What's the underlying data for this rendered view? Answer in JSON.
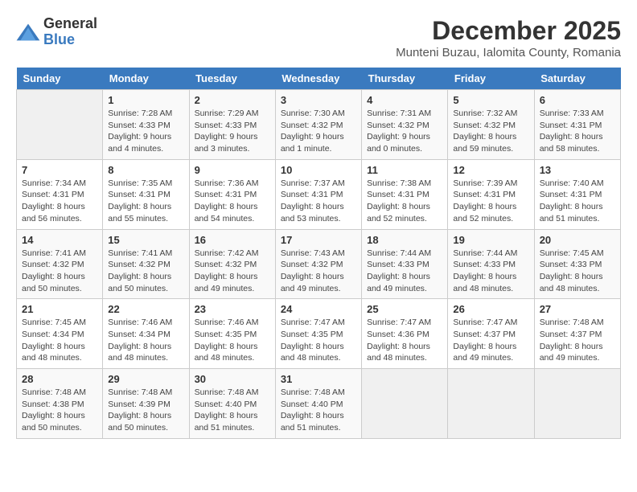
{
  "logo": {
    "text_general": "General",
    "text_blue": "Blue"
  },
  "title": {
    "month_year": "December 2025",
    "location": "Munteni Buzau, Ialomita County, Romania"
  },
  "days_of_week": [
    "Sunday",
    "Monday",
    "Tuesday",
    "Wednesday",
    "Thursday",
    "Friday",
    "Saturday"
  ],
  "weeks": [
    [
      {
        "day": "",
        "info": ""
      },
      {
        "day": "1",
        "info": "Sunrise: 7:28 AM\nSunset: 4:33 PM\nDaylight: 9 hours\nand 4 minutes."
      },
      {
        "day": "2",
        "info": "Sunrise: 7:29 AM\nSunset: 4:33 PM\nDaylight: 9 hours\nand 3 minutes."
      },
      {
        "day": "3",
        "info": "Sunrise: 7:30 AM\nSunset: 4:32 PM\nDaylight: 9 hours\nand 1 minute."
      },
      {
        "day": "4",
        "info": "Sunrise: 7:31 AM\nSunset: 4:32 PM\nDaylight: 9 hours\nand 0 minutes."
      },
      {
        "day": "5",
        "info": "Sunrise: 7:32 AM\nSunset: 4:32 PM\nDaylight: 8 hours\nand 59 minutes."
      },
      {
        "day": "6",
        "info": "Sunrise: 7:33 AM\nSunset: 4:31 PM\nDaylight: 8 hours\nand 58 minutes."
      }
    ],
    [
      {
        "day": "7",
        "info": "Sunrise: 7:34 AM\nSunset: 4:31 PM\nDaylight: 8 hours\nand 56 minutes."
      },
      {
        "day": "8",
        "info": "Sunrise: 7:35 AM\nSunset: 4:31 PM\nDaylight: 8 hours\nand 55 minutes."
      },
      {
        "day": "9",
        "info": "Sunrise: 7:36 AM\nSunset: 4:31 PM\nDaylight: 8 hours\nand 54 minutes."
      },
      {
        "day": "10",
        "info": "Sunrise: 7:37 AM\nSunset: 4:31 PM\nDaylight: 8 hours\nand 53 minutes."
      },
      {
        "day": "11",
        "info": "Sunrise: 7:38 AM\nSunset: 4:31 PM\nDaylight: 8 hours\nand 52 minutes."
      },
      {
        "day": "12",
        "info": "Sunrise: 7:39 AM\nSunset: 4:31 PM\nDaylight: 8 hours\nand 52 minutes."
      },
      {
        "day": "13",
        "info": "Sunrise: 7:40 AM\nSunset: 4:31 PM\nDaylight: 8 hours\nand 51 minutes."
      }
    ],
    [
      {
        "day": "14",
        "info": "Sunrise: 7:41 AM\nSunset: 4:32 PM\nDaylight: 8 hours\nand 50 minutes."
      },
      {
        "day": "15",
        "info": "Sunrise: 7:41 AM\nSunset: 4:32 PM\nDaylight: 8 hours\nand 50 minutes."
      },
      {
        "day": "16",
        "info": "Sunrise: 7:42 AM\nSunset: 4:32 PM\nDaylight: 8 hours\nand 49 minutes."
      },
      {
        "day": "17",
        "info": "Sunrise: 7:43 AM\nSunset: 4:32 PM\nDaylight: 8 hours\nand 49 minutes."
      },
      {
        "day": "18",
        "info": "Sunrise: 7:44 AM\nSunset: 4:33 PM\nDaylight: 8 hours\nand 49 minutes."
      },
      {
        "day": "19",
        "info": "Sunrise: 7:44 AM\nSunset: 4:33 PM\nDaylight: 8 hours\nand 48 minutes."
      },
      {
        "day": "20",
        "info": "Sunrise: 7:45 AM\nSunset: 4:33 PM\nDaylight: 8 hours\nand 48 minutes."
      }
    ],
    [
      {
        "day": "21",
        "info": "Sunrise: 7:45 AM\nSunset: 4:34 PM\nDaylight: 8 hours\nand 48 minutes."
      },
      {
        "day": "22",
        "info": "Sunrise: 7:46 AM\nSunset: 4:34 PM\nDaylight: 8 hours\nand 48 minutes."
      },
      {
        "day": "23",
        "info": "Sunrise: 7:46 AM\nSunset: 4:35 PM\nDaylight: 8 hours\nand 48 minutes."
      },
      {
        "day": "24",
        "info": "Sunrise: 7:47 AM\nSunset: 4:35 PM\nDaylight: 8 hours\nand 48 minutes."
      },
      {
        "day": "25",
        "info": "Sunrise: 7:47 AM\nSunset: 4:36 PM\nDaylight: 8 hours\nand 48 minutes."
      },
      {
        "day": "26",
        "info": "Sunrise: 7:47 AM\nSunset: 4:37 PM\nDaylight: 8 hours\nand 49 minutes."
      },
      {
        "day": "27",
        "info": "Sunrise: 7:48 AM\nSunset: 4:37 PM\nDaylight: 8 hours\nand 49 minutes."
      }
    ],
    [
      {
        "day": "28",
        "info": "Sunrise: 7:48 AM\nSunset: 4:38 PM\nDaylight: 8 hours\nand 50 minutes."
      },
      {
        "day": "29",
        "info": "Sunrise: 7:48 AM\nSunset: 4:39 PM\nDaylight: 8 hours\nand 50 minutes."
      },
      {
        "day": "30",
        "info": "Sunrise: 7:48 AM\nSunset: 4:40 PM\nDaylight: 8 hours\nand 51 minutes."
      },
      {
        "day": "31",
        "info": "Sunrise: 7:48 AM\nSunset: 4:40 PM\nDaylight: 8 hours\nand 51 minutes."
      },
      {
        "day": "",
        "info": ""
      },
      {
        "day": "",
        "info": ""
      },
      {
        "day": "",
        "info": ""
      }
    ]
  ]
}
